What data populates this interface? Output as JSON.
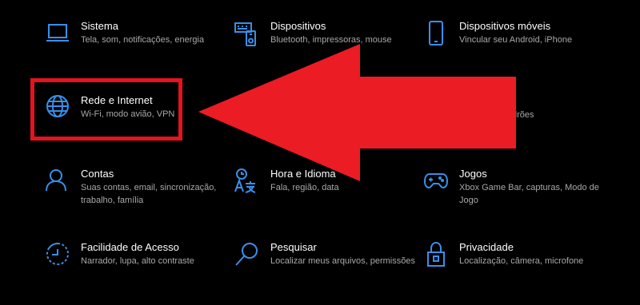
{
  "colors": {
    "accent": "#3a8fe8",
    "background": "#000000",
    "annotation": "#ec1c24"
  },
  "tiles": [
    {
      "icon": "laptop-icon",
      "title": "Sistema",
      "desc": "Tela, som, notificações, energia"
    },
    {
      "icon": "devices-icon",
      "title": "Dispositivos",
      "desc": "Bluetooth, impressoras, mouse"
    },
    {
      "icon": "phone-icon",
      "title": "Dispositivos móveis",
      "desc": "Vincular seu Android, iPhone"
    },
    {
      "icon": "globe-icon",
      "title": "Rede e Internet",
      "desc": "Wi-Fi, modo avião, VPN"
    },
    {
      "icon": "person-icon",
      "title": "Contas",
      "desc": "Suas contas, email, sincronização, trabalho, família"
    },
    {
      "icon": "time-language-icon",
      "title": "Hora e Idioma",
      "desc": "Fala, região, data"
    },
    {
      "icon": "gamepad-icon",
      "title": "Jogos",
      "desc": "Xbox Game Bar, capturas, Modo de Jogo"
    },
    {
      "icon": "accessibility-icon",
      "title": "Facilidade de Acesso",
      "desc": "Narrador, lupa, alto contraste"
    },
    {
      "icon": "search-icon",
      "title": "Pesquisar",
      "desc": "Localizar meus arquivos, permissões"
    },
    {
      "icon": "lock-icon",
      "title": "Privacidade",
      "desc": "Localização, câmera, microfone"
    }
  ],
  "partial_text": "drões"
}
